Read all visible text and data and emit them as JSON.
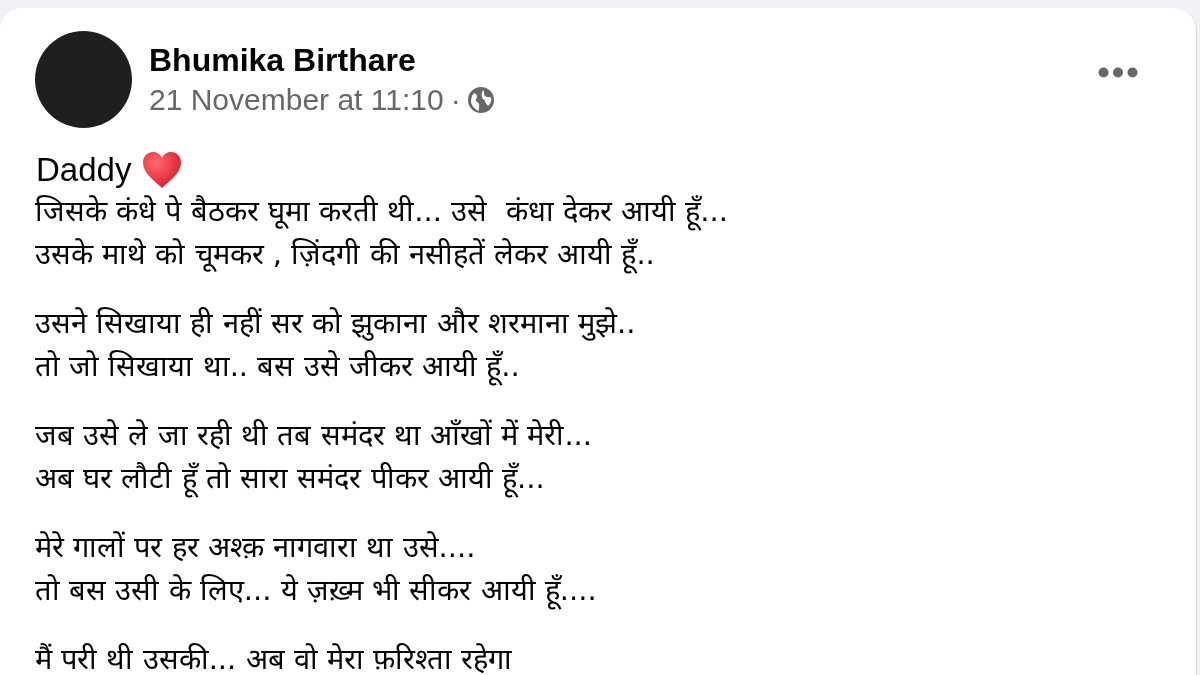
{
  "post": {
    "author": "Bhumika Birthare",
    "timestamp": "21 November at 11:10",
    "separator": "·",
    "title": "Daddy",
    "stanzas": [
      {
        "lines": [
          "जिसके कंधे पे बैठकर घूमा करती थी... उसे  कंधा देकर आयी हूँ...",
          "उसके माथे को चूमकर , ज़िंदगी की नसीहतें लेकर आयी हूँ.."
        ]
      },
      {
        "lines": [
          "उसने सिखाया ही नहीं सर को झुकाना और शरमाना मुझे..",
          "तो जो सिखाया था.. बस उसे जीकर आयी हूँ.."
        ]
      },
      {
        "lines": [
          "जब उसे ले जा रही थी तब समंदर था आँखों में मेरी...",
          "अब घर लौटी हूँ तो सारा समंदर पीकर आयी हूँ..."
        ]
      },
      {
        "lines": [
          "मेरे गालों पर हर अश्क़ नागवारा था उसे....",
          "तो बस उसी के लिए... ये ज़ख़्म भी सीकर आयी हूँ...."
        ]
      },
      {
        "lines": [
          "मैं परी थी उसकी... अब वो मेरा फ़रिश्ता रहेगा"
        ]
      }
    ]
  }
}
